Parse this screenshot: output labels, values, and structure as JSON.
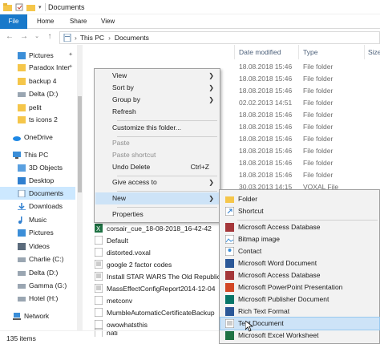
{
  "window": {
    "title": "Documents"
  },
  "ribbon": {
    "tabs": [
      "File",
      "Home",
      "Share",
      "View"
    ]
  },
  "address": {
    "crumbs": [
      "This PC",
      "Documents"
    ],
    "separator": "›"
  },
  "sidebar": {
    "items": [
      "Pictures",
      "Paradox Inter",
      "backup 4",
      "Delta (D:)",
      "pelit",
      "ts icons 2",
      "OneDrive",
      "This PC",
      "3D Objects",
      "Desktop",
      "Documents",
      "Downloads",
      "Music",
      "Pictures",
      "Videos",
      "Charlie (C:)",
      "Delta (D:)",
      "Gamma (G:)",
      "Hotel (H:)",
      "Network"
    ]
  },
  "columns": {
    "date": "Date modified",
    "type": "Type",
    "size": "Size"
  },
  "rows": [
    {
      "date": "18.08.2018 15:46",
      "type": "File folder"
    },
    {
      "date": "18.08.2018 15:46",
      "type": "File folder"
    },
    {
      "date": "18.08.2018 15:46",
      "type": "File folder"
    },
    {
      "date": "02.02.2013 14:51",
      "type": "File folder"
    },
    {
      "date": "18.08.2018 15:46",
      "type": "File folder"
    },
    {
      "date": "18.08.2018 15:46",
      "type": "File folder"
    },
    {
      "date": "18.08.2018 15:46",
      "type": "File folder"
    },
    {
      "date": "18.08.2018 15:46",
      "type": "File folder"
    },
    {
      "date": "18.08.2018 15:46",
      "type": "File folder"
    },
    {
      "date": "18.08.2018 15:46",
      "type": "File folder"
    },
    {
      "date": "30.03.2013 14:15",
      "type": "VOXAL File"
    }
  ],
  "files": [
    "corsair_cue_18-08-2018_16-42-42",
    "Default",
    "distorted.voxal",
    "google 2 factor codes",
    "Install STAR WARS The Old Republic",
    "MassEffectConfigReport2014-12-04",
    "metconv",
    "MumbleAutomaticCertificateBackup",
    "owowhatsthis",
    "nati"
  ],
  "context_menu": {
    "view": "View",
    "sort_by": "Sort by",
    "group_by": "Group by",
    "refresh": "Refresh",
    "customize": "Customize this folder...",
    "paste": "Paste",
    "paste_shortcut": "Paste shortcut",
    "undo_delete": "Undo Delete",
    "undo_shortcut": "Ctrl+Z",
    "give_access": "Give access to",
    "new": "New",
    "properties": "Properties"
  },
  "new_submenu": [
    "Folder",
    "Shortcut",
    "Microsoft Access Database",
    "Bitmap image",
    "Contact",
    "Microsoft Word Document",
    "Microsoft Access Database",
    "Microsoft PowerPoint Presentation",
    "Microsoft Publisher Document",
    "Rich Text Format",
    "Text Document",
    "Microsoft Excel Worksheet"
  ],
  "status": {
    "item_count": "135 items"
  },
  "colors": {
    "accent": "#1979ca",
    "selection": "#cce8ff",
    "hover": "#cde3f7",
    "folder": "#f5c64a"
  }
}
